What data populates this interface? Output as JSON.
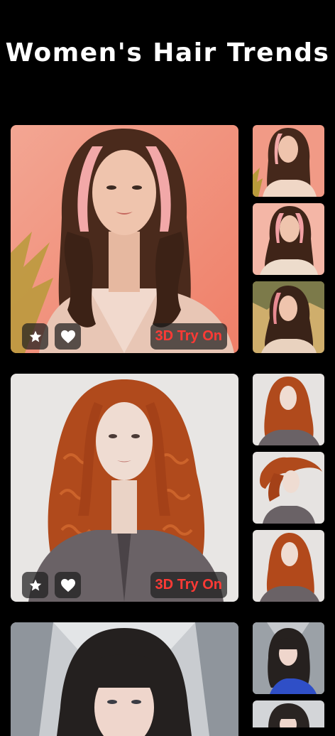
{
  "header": {
    "title": "Women's Hair Trends"
  },
  "actions": {
    "try_on_label": "3D Try On"
  },
  "colors": {
    "background": "#000000",
    "try_on_text": "#ff3a35",
    "button_bg": "rgba(30,30,30,0.72)"
  },
  "sections": [
    {
      "style": "pink-highlight-waves",
      "icons": [
        "star-icon",
        "heart-icon"
      ],
      "thumbnails": 3
    },
    {
      "style": "copper-curls",
      "icons": [
        "star-icon",
        "heart-icon"
      ],
      "thumbnails": 3
    },
    {
      "style": "dark-bangs",
      "icons": [],
      "thumbnails": 2
    }
  ]
}
